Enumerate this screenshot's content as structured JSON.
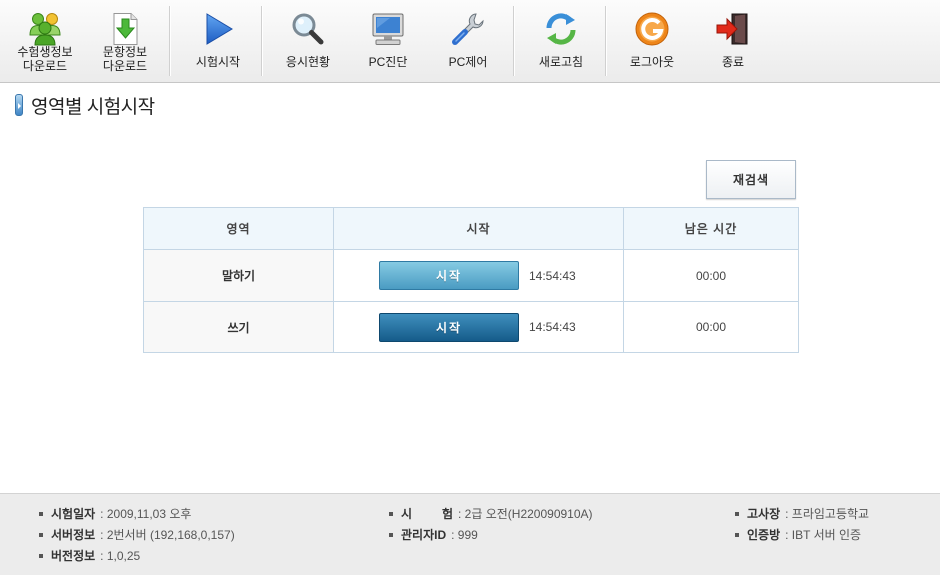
{
  "toolbar": {
    "items": [
      {
        "icon": "users-icon",
        "lines": [
          "수험생정보",
          "다운로드"
        ]
      },
      {
        "icon": "download-icon",
        "lines": [
          "문항정보",
          "다운로드"
        ]
      },
      {
        "icon": "play-icon",
        "lines": [
          "시험시작"
        ]
      },
      {
        "icon": "search-icon",
        "lines": [
          "응시현황"
        ]
      },
      {
        "icon": "monitor-icon",
        "lines": [
          "PC진단"
        ]
      },
      {
        "icon": "wrench-icon",
        "lines": [
          "PC제어"
        ]
      },
      {
        "icon": "refresh-icon",
        "lines": [
          "새로고침"
        ]
      },
      {
        "icon": "logout-icon",
        "lines": [
          "로그아웃"
        ]
      },
      {
        "icon": "exit-icon",
        "lines": [
          "종료"
        ]
      }
    ]
  },
  "page": {
    "title": "영역별 시험시작",
    "title_icon": "title-marker-icon"
  },
  "search": {
    "research_label": "재검색"
  },
  "table": {
    "headers": [
      "영역",
      "시작",
      "남은 시간"
    ],
    "rows": [
      {
        "area": "말하기",
        "start_label": "시작",
        "start_time": "14:54:43",
        "remaining": "00:00",
        "button_color": "#5aaccd"
      },
      {
        "area": "쓰기",
        "start_label": "시작",
        "start_time": "14:54:43",
        "remaining": "00:00",
        "button_color": "#1f6c99"
      }
    ]
  },
  "footer": {
    "left": [
      {
        "label": "시험일자",
        "value": ": 2009,11,03 오후"
      },
      {
        "label": "서버정보",
        "value": ": 2번서버 (192,168,0,157)"
      },
      {
        "label": "버전정보",
        "value": ": 1,0,25"
      }
    ],
    "middle": [
      {
        "label": "시 험",
        "value": ": 2급 오전(H220090910A)"
      },
      {
        "label": "관리자ID",
        "value": ": 999"
      }
    ],
    "right": [
      {
        "label": "고사장",
        "value": ": 프라임고등학교"
      },
      {
        "label": "인증방",
        "value": ": IBT 서버 인증"
      }
    ]
  },
  "colors": {
    "toolbar_bg": "#f3f3f3",
    "table_header_bg": "#eff7fc",
    "table_border": "#c4d6e5",
    "footer_bg": "#ececec",
    "accent_blue": "#3f86c6"
  }
}
